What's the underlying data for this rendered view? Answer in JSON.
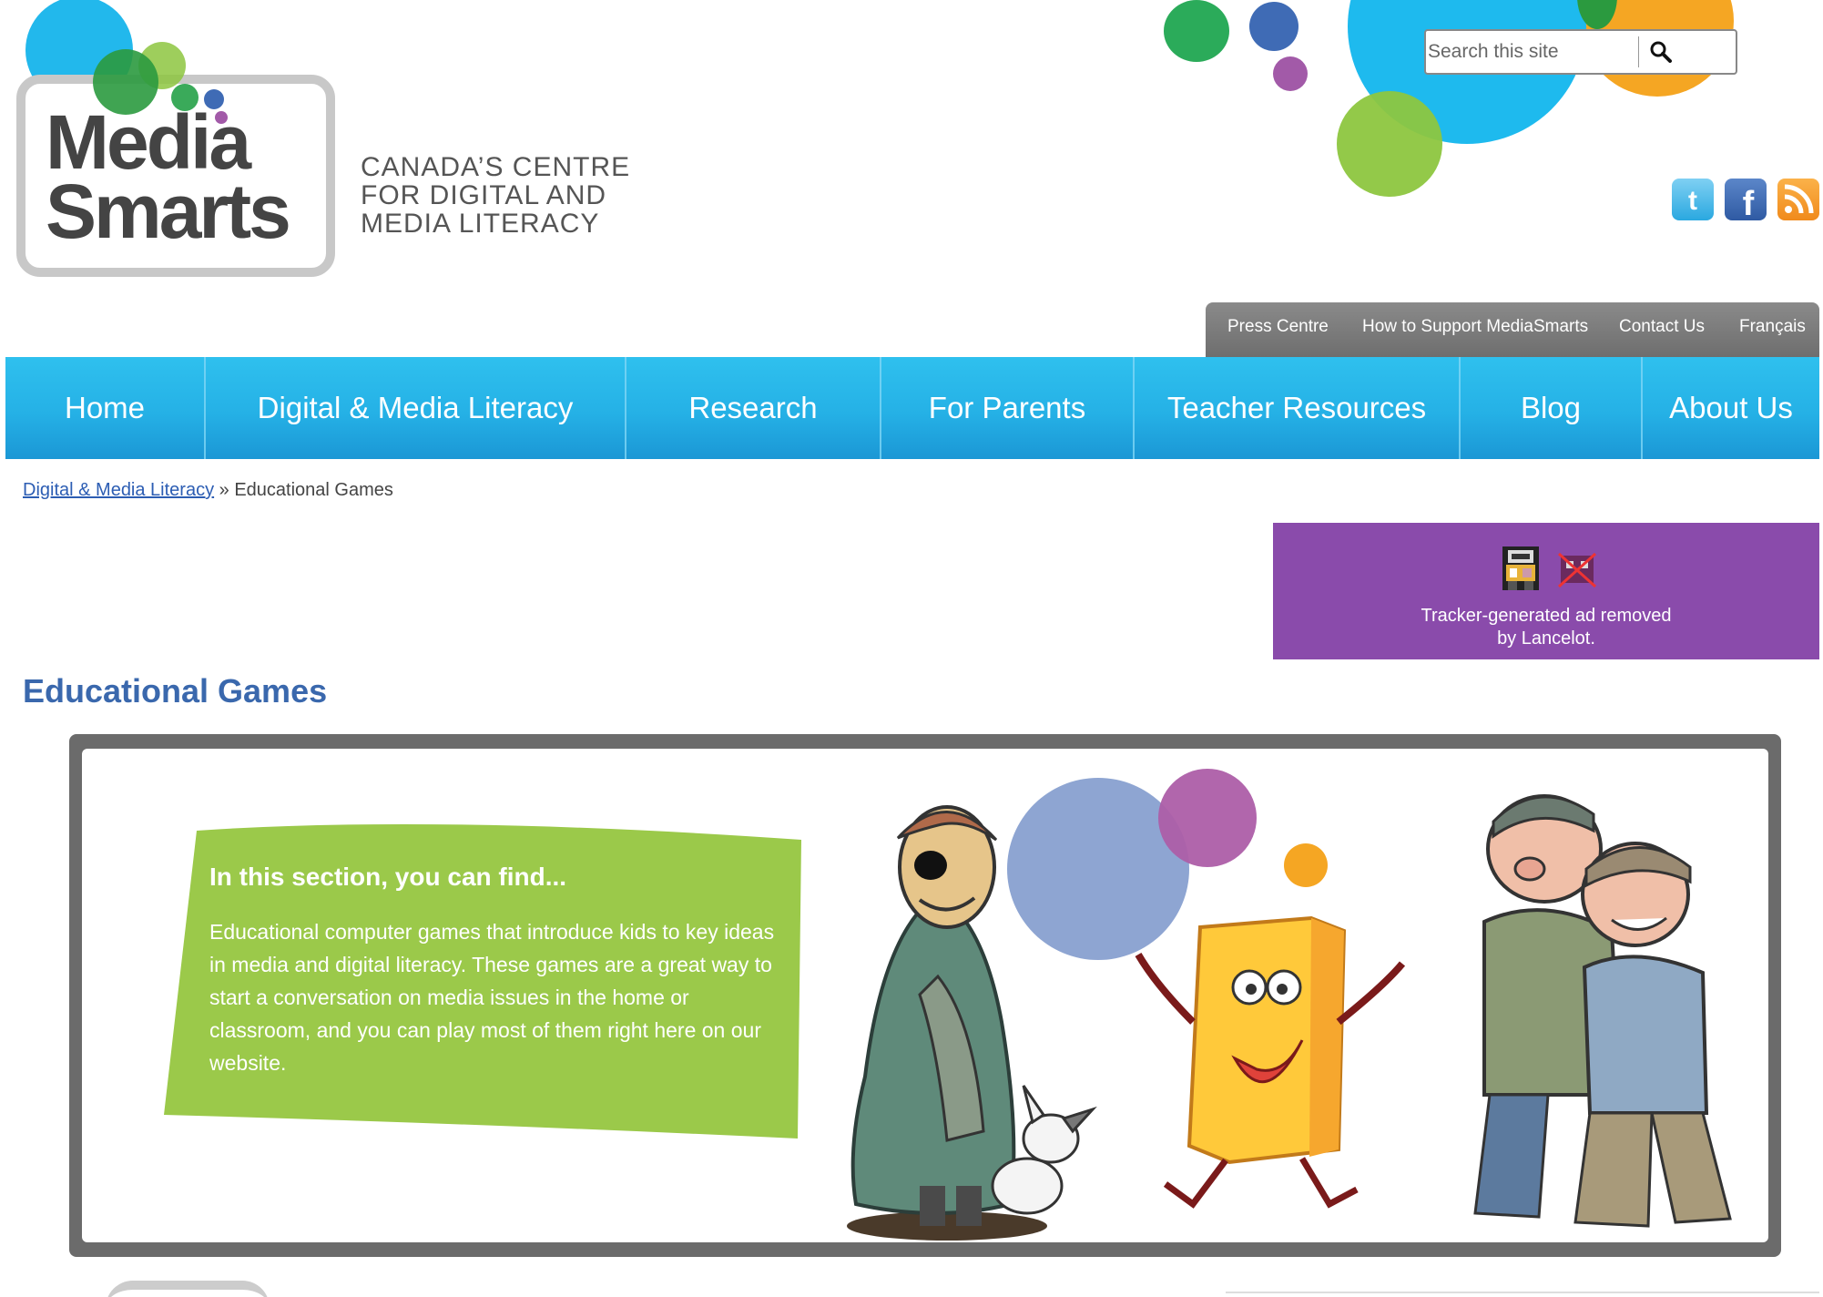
{
  "logo": {
    "word_line1": "Media",
    "word_line2": "Smarts",
    "tagline": [
      "CANADA’S CENTRE",
      "FOR DIGITAL AND",
      "MEDIA LITERACY"
    ]
  },
  "search": {
    "placeholder": "Search this site",
    "button_icon": "search-icon"
  },
  "social": [
    "twitter-icon",
    "facebook-icon",
    "rss-icon"
  ],
  "utility_nav": [
    "Press Centre",
    "How to Support MediaSmarts",
    "Contact Us",
    "Français"
  ],
  "main_nav": [
    "Home",
    "Digital & Media Literacy",
    "Research",
    "For Parents",
    "Teacher Resources",
    "Blog",
    "About Us"
  ],
  "breadcrumb": {
    "link": "Digital & Media Literacy",
    "separator": "»",
    "current": "Educational Games"
  },
  "ad": {
    "text_line1": "Tracker-generated ad removed",
    "text_line2": "by Lancelot."
  },
  "page_title": "Educational Games",
  "feature": {
    "title": "In this section, you can find...",
    "body": "Educational computer games that introduce kids to key ideas in media and digital literacy. These games are a great way to start a conversation on media issues in the home or classroom, and you can play most of them right here on our website."
  },
  "colors": {
    "nav_blue": "#25b1e6",
    "title_blue": "#3a68ad",
    "intro_green": "#9bc94a",
    "ad_purple": "#8a4bab"
  }
}
